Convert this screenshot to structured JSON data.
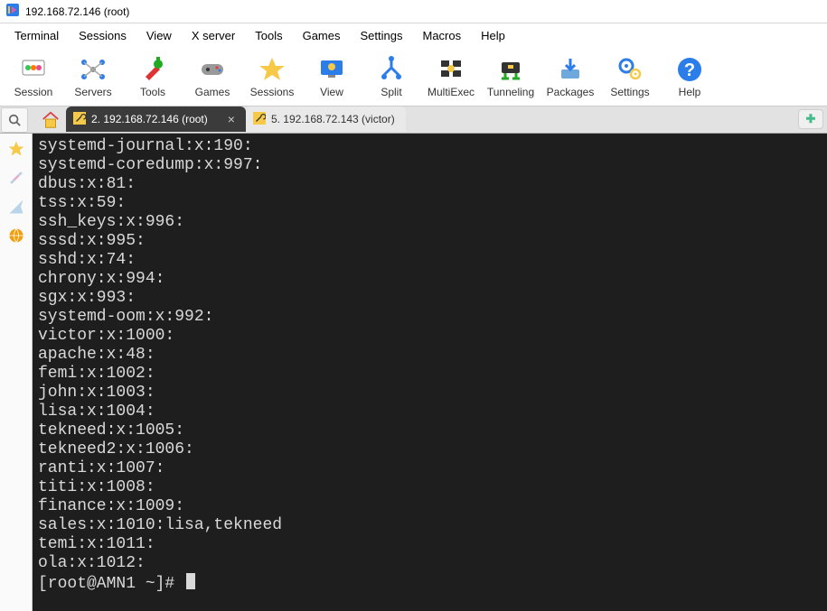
{
  "window": {
    "title": "192.168.72.146 (root)"
  },
  "menubar": [
    "Terminal",
    "Sessions",
    "View",
    "X server",
    "Tools",
    "Games",
    "Settings",
    "Macros",
    "Help"
  ],
  "toolbar": [
    {
      "id": "session",
      "label": "Session"
    },
    {
      "id": "servers",
      "label": "Servers"
    },
    {
      "id": "tools",
      "label": "Tools"
    },
    {
      "id": "games",
      "label": "Games"
    },
    {
      "id": "sessions",
      "label": "Sessions"
    },
    {
      "id": "view",
      "label": "View"
    },
    {
      "id": "split",
      "label": "Split"
    },
    {
      "id": "multiexec",
      "label": "MultiExec"
    },
    {
      "id": "tunneling",
      "label": "Tunneling"
    },
    {
      "id": "packages",
      "label": "Packages"
    },
    {
      "id": "settings",
      "label": "Settings"
    },
    {
      "id": "help",
      "label": "Help"
    }
  ],
  "tabs": {
    "active": {
      "index": 2,
      "label": "2. 192.168.72.146 (root)"
    },
    "inactive": {
      "index": 5,
      "label": "5. 192.168.72.143 (victor)"
    }
  },
  "terminal": {
    "lines": [
      "systemd-journal:x:190:",
      "systemd-coredump:x:997:",
      "dbus:x:81:",
      "tss:x:59:",
      "ssh_keys:x:996:",
      "sssd:x:995:",
      "sshd:x:74:",
      "chrony:x:994:",
      "sgx:x:993:",
      "systemd-oom:x:992:",
      "victor:x:1000:",
      "apache:x:48:",
      "femi:x:1002:",
      "john:x:1003:",
      "lisa:x:1004:",
      "tekneed:x:1005:",
      "tekneed2:x:1006:",
      "ranti:x:1007:",
      "titi:x:1008:",
      "finance:x:1009:",
      "sales:x:1010:lisa,tekneed",
      "temi:x:1011:",
      "ola:x:1012:"
    ],
    "prompt": "[root@AMN1 ~]#"
  }
}
